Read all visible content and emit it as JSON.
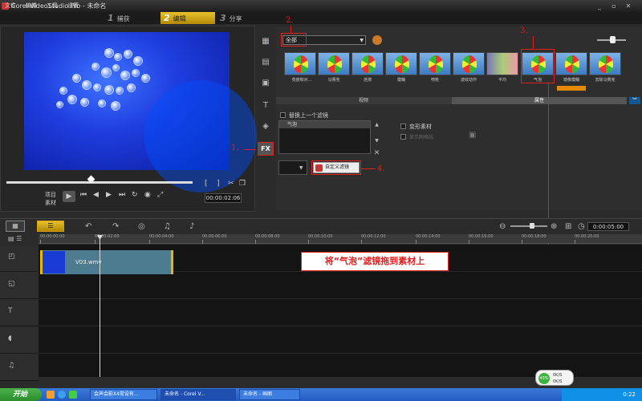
{
  "window": {
    "title": "Corel VideoStudio Pro - 未命名",
    "minimize": "_",
    "restore": "▫",
    "close": "✕"
  },
  "menu": [
    "文件",
    "编辑",
    "工具",
    "设置"
  ],
  "steps": [
    {
      "num": "1",
      "label": "捕获"
    },
    {
      "num": "2",
      "label": "编辑"
    },
    {
      "num": "3",
      "label": "分享"
    }
  ],
  "preview": {
    "mode_project": "项目",
    "mode_clip": "素材",
    "timecode": "00:00:02:06",
    "bracket_in": "[",
    "bracket_out": "]"
  },
  "library": {
    "category": "全部",
    "thumbs": [
      "亮度和对...",
      "马赛克",
      "涟漪",
      "模糊",
      "喷枪",
      "波纹动作",
      "平均",
      "气泡",
      "镜像模糊",
      "去除马赛克"
    ],
    "tab_video": "视频",
    "tab_props": "属性",
    "expand_icon": "︾"
  },
  "properties": {
    "replace_last": "替换上一个滤镜",
    "filter_item": "气泡",
    "morph": "变形素材",
    "show_grid": "显示网格线",
    "custom_filter": "自定义滤镜"
  },
  "annotations": {
    "a1": "1.",
    "a2": "2.",
    "a3": "3.",
    "a4": "4.",
    "drag": "将“气泡”滤镜拖到素材上"
  },
  "timeline": {
    "timecode": "0:00:05:00",
    "ruler": [
      "00:00:00:00",
      "00:00:02:00",
      "00:00:04:00",
      "00:00:06:00",
      "00:00:08:00",
      "00:00:10:00",
      "00:00:12:00",
      "00:00:14:00",
      "00:00:16:00",
      "00:00:18:00",
      "00:00:20:00"
    ],
    "clip_name": "V03.wmv"
  },
  "taskbar": {
    "start": "开始",
    "tasks": [
      "会声会影X4常设有...",
      "未命名 - Corel V...",
      "未命名 - 画图"
    ],
    "clock": "0:22",
    "net_pct": "43%",
    "net_up": "0K/S",
    "net_down": "0K/S"
  },
  "colors": {
    "accent": "#e6c12a",
    "annotation_red": "#e02020",
    "video_blue": "#1f3ee0"
  }
}
